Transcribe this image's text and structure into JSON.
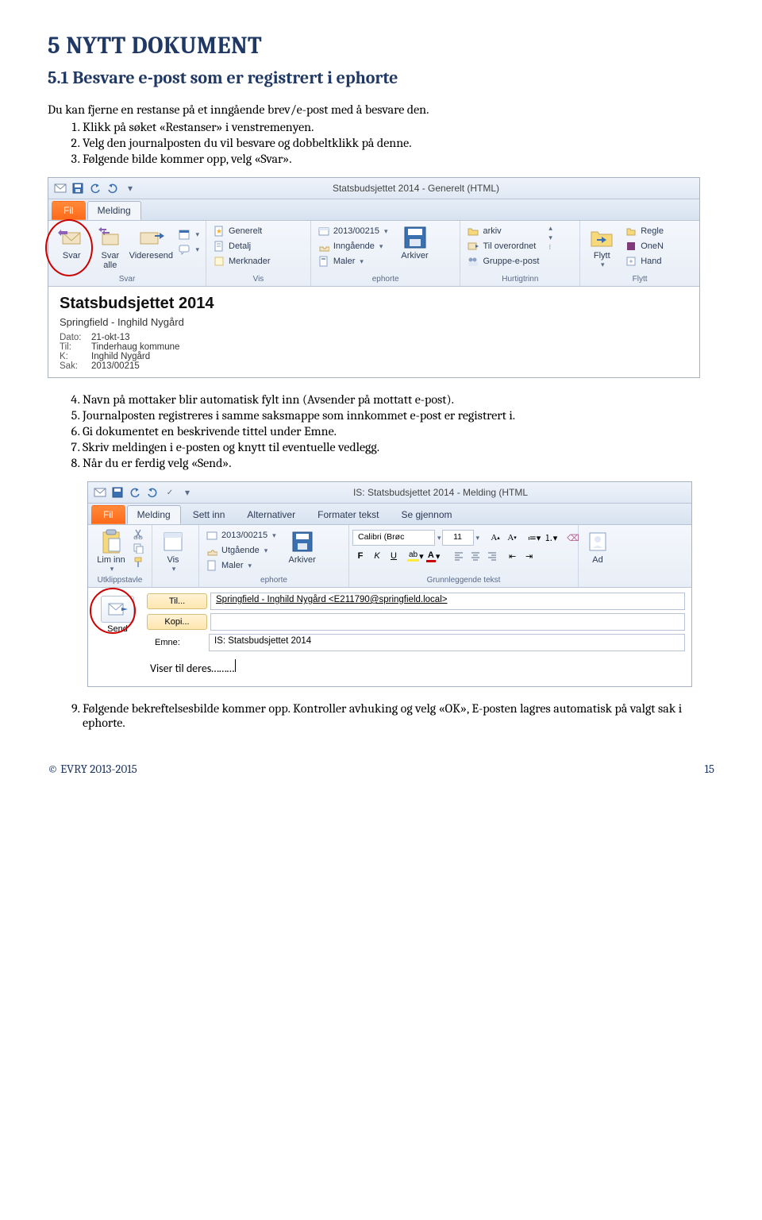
{
  "heading": "5   NYTT DOKUMENT",
  "subheading": "5.1   Besvare e-post som er registrert i ephorte",
  "intro": "Du kan fjerne en restanse på et inngående brev/e-post med å besvare den.",
  "steps_a": [
    "Klikk på søket «Restanser» i venstremenyen.",
    "Velg den journalposten du vil besvare og dobbeltklikk på denne.",
    "Følgende bilde kommer opp, velg «Svar»."
  ],
  "steps_b": [
    "Navn på mottaker blir automatisk fylt inn (Avsender på mottatt e-post).",
    "Journalposten registreres i samme saksmappe som innkommet e-post er registrert i.",
    "Gi dokumentet en beskrivende tittel under Emne.",
    "Skriv meldingen i e-posten og knytt til eventuelle vedlegg.",
    "Når du er ferdig velg «Send»."
  ],
  "steps_c": [
    "Følgende bekreftelsesbilde kommer opp. Kontroller avhuking og velg «OK», E-posten lagres automatisk på valgt sak i ephorte."
  ],
  "oread": {
    "title": "Statsbudsjettet 2014  -  Generelt (HTML)",
    "tabs": {
      "fil": "Fil",
      "melding": "Melding"
    },
    "groups": {
      "svar": {
        "svar": "Svar",
        "svar_alle": "Svar alle",
        "videresend": "Videresend",
        "label": "Svar"
      },
      "vis": {
        "generelt": "Generelt",
        "detalj": "Detalj",
        "merknader": "Merknader",
        "label": "Vis"
      },
      "ephorte": {
        "sak": "2013/00215",
        "inng": "Inngående",
        "maler": "Maler",
        "arkiver": "Arkiver",
        "label": "ephorte"
      },
      "hurtig": {
        "arkiv": "arkiv",
        "overordnet": "Til overordnet",
        "gruppe": "Gruppe-e-post",
        "label": "Hurtigtrinn"
      },
      "flytt": {
        "flytt": "Flytt",
        "regle": "Regle",
        "one": "OneN",
        "hand": "Hand",
        "label": "Flytt"
      }
    },
    "msg": {
      "subject": "Statsbudsjettet 2014",
      "from": "Springfield - Inghild Nygård",
      "dato_k": "Dato:",
      "dato_v": "21-okt-13",
      "til_k": "Til:",
      "til_v": "Tinderhaug kommune",
      "kopi_k": "K:",
      "kopi_v": "Inghild Nygård",
      "sak_k": "Sak:",
      "sak_v": "2013/00215"
    }
  },
  "ocomp": {
    "title": "IS: Statsbudsjettet 2014  -  Melding (HTML",
    "tabs": {
      "fil": "Fil",
      "melding": "Melding",
      "settinn": "Sett inn",
      "alt": "Alternativer",
      "fmt": "Formater tekst",
      "seg": "Se gjennom"
    },
    "groups": {
      "klipp": {
        "lim": "Lim inn",
        "label": "Utklippstavle"
      },
      "vis": {
        "vis": "Vis",
        "label": ""
      },
      "ephorte": {
        "sak": "2013/00215",
        "utg": "Utgående",
        "maler": "Maler",
        "arkiver": "Arkiver",
        "label": "ephorte"
      },
      "tekst": {
        "font": "Calibri (Brøc",
        "size": "11",
        "bold": "F",
        "italic": "K",
        "under": "U",
        "label": "Grunnleggende tekst"
      },
      "ad": {
        "ad": "Ad"
      }
    },
    "send": "Send",
    "til_label": "Til...",
    "til_value": "Springfield - Inghild Nygård <E211790@springfield.local>",
    "kopi_label": "Kopi...",
    "emne_label": "Emne:",
    "emne_value": "IS: Statsbudsjettet 2014",
    "body": "Viser til deres………"
  },
  "footer": {
    "copy": "© EVRY 2013-2015",
    "page": "15"
  }
}
